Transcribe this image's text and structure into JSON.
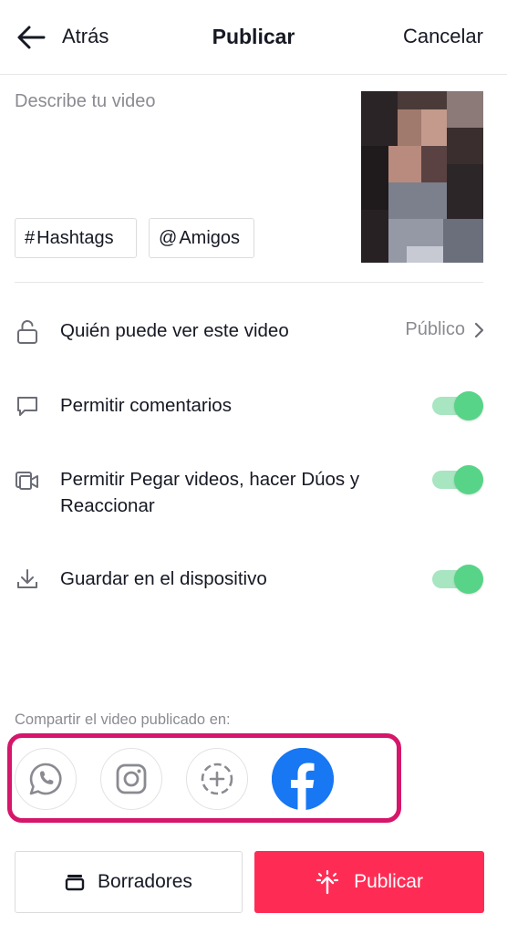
{
  "header": {
    "back_label": "Atrás",
    "title": "Publicar",
    "cancel_label": "Cancelar"
  },
  "description": {
    "placeholder": "Describe tu video",
    "value": ""
  },
  "chips": {
    "hashtags": {
      "symbol": "#",
      "label": "Hashtags"
    },
    "friends": {
      "symbol": "@",
      "label": "Amigos"
    }
  },
  "settings": {
    "privacy": {
      "label": "Quién puede ver este video",
      "value": "Público",
      "icon": "lock-open-icon"
    },
    "comments": {
      "label": "Permitir comentarios",
      "enabled": true,
      "icon": "comment-icon"
    },
    "duet": {
      "label_line1": "Permitir Pegar videos, hacer Dúos y",
      "label_line2": "Reaccionar",
      "enabled": true,
      "icon": "duet-icon"
    },
    "save": {
      "label": "Guardar en el dispositivo",
      "enabled": true,
      "icon": "download-icon"
    }
  },
  "share": {
    "label": "Compartir el video publicado en:",
    "targets": [
      {
        "name": "WhatsApp",
        "icon": "whatsapp-icon",
        "selected": false
      },
      {
        "name": "Instagram",
        "icon": "instagram-icon",
        "selected": false
      },
      {
        "name": "Stories",
        "icon": "add-story-icon",
        "selected": false
      },
      {
        "name": "Facebook",
        "icon": "facebook-icon",
        "selected": true
      }
    ]
  },
  "footer": {
    "drafts_label": "Borradores",
    "publish_label": "Publicar"
  },
  "colors": {
    "accent": "#fe2c55",
    "toggle_on": "#57d487",
    "highlight": "#d5166a",
    "facebook": "#1877f2",
    "secondary_text": "#8a8b91"
  }
}
